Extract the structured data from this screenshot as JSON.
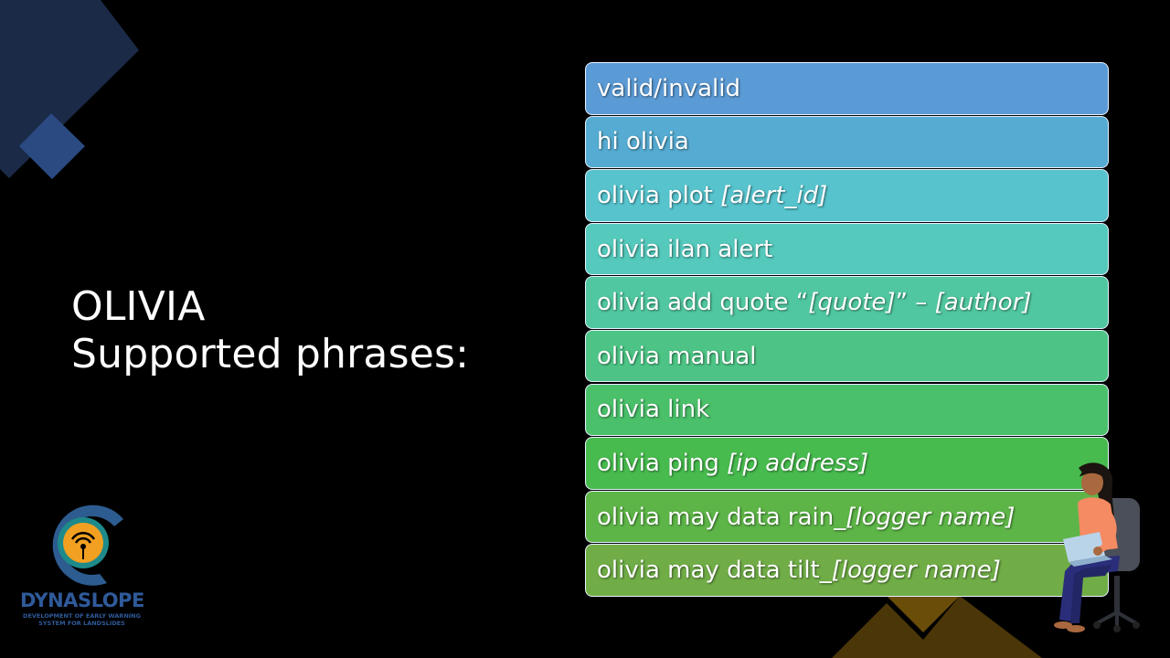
{
  "slide": {
    "title_line1": "OLIVIA",
    "title_line2": "Supported phrases:"
  },
  "phrases": [
    {
      "text": "valid/invalid",
      "arg": "",
      "tail": "",
      "arg2": "",
      "color": "#5b9bd5"
    },
    {
      "text": "hi olivia",
      "arg": "",
      "tail": "",
      "arg2": "",
      "color": "#55abd1"
    },
    {
      "text": "olivia plot ",
      "arg": "[alert_id]",
      "tail": "",
      "arg2": "",
      "color": "#56c3cd"
    },
    {
      "text": "olivia ilan alert",
      "arg": "",
      "tail": "",
      "arg2": "",
      "color": "#54c9bc"
    },
    {
      "text": "olivia add quote “",
      "arg": "[quote]",
      "tail": "” – ",
      "arg2": "[author]",
      "color": "#50c7a0"
    },
    {
      "text": "olivia manual",
      "arg": "",
      "tail": "",
      "arg2": "",
      "color": "#4dc485"
    },
    {
      "text": "olivia link",
      "arg": "",
      "tail": "",
      "arg2": "",
      "color": "#4ac06a"
    },
    {
      "text": "olivia ping ",
      "arg": "[ip address]",
      "tail": "",
      "arg2": "",
      "color": "#47bb4e"
    },
    {
      "text": "olivia may data rain_",
      "arg": "[logger name]",
      "tail": "",
      "arg2": "",
      "color": "#5db547"
    },
    {
      "text": "olivia may data tilt_",
      "arg": "[logger name]",
      "tail": "",
      "arg2": "",
      "color": "#70ad47"
    }
  ],
  "logo": {
    "word": "DYNASLOPE",
    "sub_line1": "DEVELOPMENT OF EARLY WARNING",
    "sub_line2": "SYSTEM FOR LANDSLIDES"
  }
}
